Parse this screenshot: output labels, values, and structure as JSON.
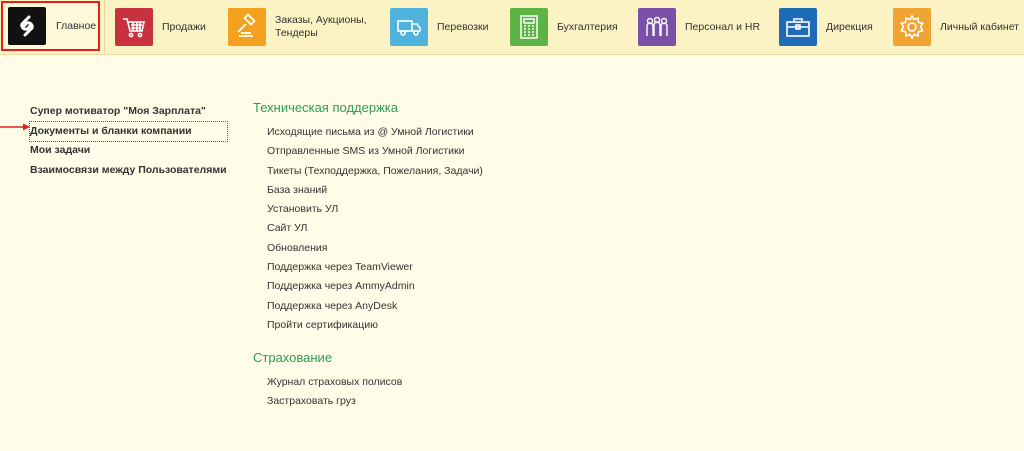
{
  "nav": {
    "home": {
      "label": "Главное",
      "icon": "brand-logo-icon",
      "color": "#111111"
    },
    "items": [
      {
        "label": "Продажи",
        "icon": "shopping-cart-icon",
        "color": "#c8313e"
      },
      {
        "label": "Заказы,  Аукционы,\nТендеры",
        "icon": "gavel-icon",
        "color": "#f4a21d"
      },
      {
        "label": "Перевозки",
        "icon": "truck-icon",
        "color": "#4fb3de"
      },
      {
        "label": "Бухгалтерия",
        "icon": "calculator-icon",
        "color": "#5db346"
      },
      {
        "label": "Персонал и HR",
        "icon": "people-icon",
        "color": "#7b4fa6"
      },
      {
        "label": "Дирекция",
        "icon": "briefcase-icon",
        "color": "#1e6bb8"
      },
      {
        "label": "Личный кабинет",
        "icon": "gear-icon",
        "color": "#f0a433"
      }
    ]
  },
  "left_links": [
    "Супер мотиватор \"Моя Зарплата\"",
    "Документы и бланки компании",
    "Мои задачи",
    "Взаимосвязи между Пользователями"
  ],
  "support": {
    "title": "Техническая поддержка",
    "links": [
      "Исходящие письма из @ Умной Логистики",
      "Отправленные SMS из Умной Логистики",
      "Тикеты (Техподдержка, Пожелания, Задачи)",
      "База знаний",
      "Установить УЛ",
      "Сайт УЛ",
      "Обновления",
      "Поддержка через TeamViewer",
      "Поддержка через AmmyAdmin",
      "Поддержка через AnyDesk",
      "Пройти сертификацию"
    ]
  },
  "insurance": {
    "title": "Страхование",
    "links": [
      "Журнал страховых полисов",
      "Застраховать груз"
    ]
  }
}
